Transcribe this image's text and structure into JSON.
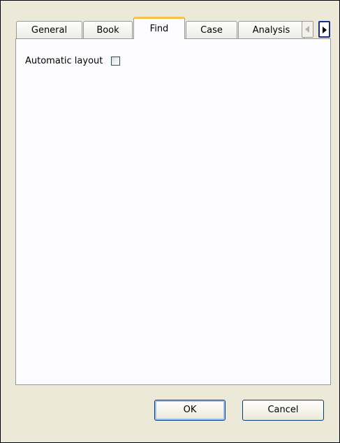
{
  "tabs": [
    {
      "label": "General",
      "active": false
    },
    {
      "label": "Book",
      "active": false
    },
    {
      "label": "Find",
      "active": true
    },
    {
      "label": "Case",
      "active": false
    },
    {
      "label": "Analysis",
      "active": false
    }
  ],
  "icons": {
    "scroll_left": "chevron-left-icon",
    "scroll_right": "chevron-right-icon"
  },
  "panel": {
    "automatic_layout_label": "Automatic layout",
    "automatic_layout_checked": false
  },
  "buttons": {
    "ok_label": "OK",
    "cancel_label": "Cancel"
  },
  "colors": {
    "window_bg": "#ece9d8",
    "panel_bg": "#fcfcfe",
    "active_tab_highlight": "#f6c04d"
  }
}
